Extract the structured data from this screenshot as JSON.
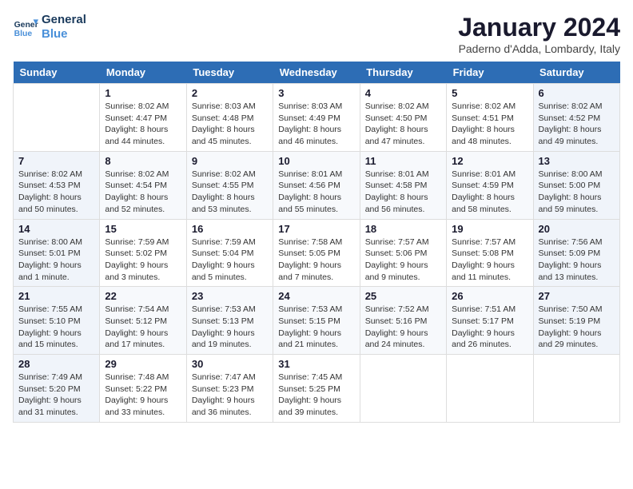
{
  "header": {
    "logo_line1": "General",
    "logo_line2": "Blue",
    "title": "January 2024",
    "location": "Paderno d'Adda, Lombardy, Italy"
  },
  "days_of_week": [
    "Sunday",
    "Monday",
    "Tuesday",
    "Wednesday",
    "Thursday",
    "Friday",
    "Saturday"
  ],
  "weeks": [
    [
      {
        "day": "",
        "sunrise": "",
        "sunset": "",
        "daylight": ""
      },
      {
        "day": "1",
        "sunrise": "Sunrise: 8:02 AM",
        "sunset": "Sunset: 4:47 PM",
        "daylight": "Daylight: 8 hours and 44 minutes."
      },
      {
        "day": "2",
        "sunrise": "Sunrise: 8:03 AM",
        "sunset": "Sunset: 4:48 PM",
        "daylight": "Daylight: 8 hours and 45 minutes."
      },
      {
        "day": "3",
        "sunrise": "Sunrise: 8:03 AM",
        "sunset": "Sunset: 4:49 PM",
        "daylight": "Daylight: 8 hours and 46 minutes."
      },
      {
        "day": "4",
        "sunrise": "Sunrise: 8:02 AM",
        "sunset": "Sunset: 4:50 PM",
        "daylight": "Daylight: 8 hours and 47 minutes."
      },
      {
        "day": "5",
        "sunrise": "Sunrise: 8:02 AM",
        "sunset": "Sunset: 4:51 PM",
        "daylight": "Daylight: 8 hours and 48 minutes."
      },
      {
        "day": "6",
        "sunrise": "Sunrise: 8:02 AM",
        "sunset": "Sunset: 4:52 PM",
        "daylight": "Daylight: 8 hours and 49 minutes."
      }
    ],
    [
      {
        "day": "7",
        "sunrise": "Sunrise: 8:02 AM",
        "sunset": "Sunset: 4:53 PM",
        "daylight": "Daylight: 8 hours and 50 minutes."
      },
      {
        "day": "8",
        "sunrise": "Sunrise: 8:02 AM",
        "sunset": "Sunset: 4:54 PM",
        "daylight": "Daylight: 8 hours and 52 minutes."
      },
      {
        "day": "9",
        "sunrise": "Sunrise: 8:02 AM",
        "sunset": "Sunset: 4:55 PM",
        "daylight": "Daylight: 8 hours and 53 minutes."
      },
      {
        "day": "10",
        "sunrise": "Sunrise: 8:01 AM",
        "sunset": "Sunset: 4:56 PM",
        "daylight": "Daylight: 8 hours and 55 minutes."
      },
      {
        "day": "11",
        "sunrise": "Sunrise: 8:01 AM",
        "sunset": "Sunset: 4:58 PM",
        "daylight": "Daylight: 8 hours and 56 minutes."
      },
      {
        "day": "12",
        "sunrise": "Sunrise: 8:01 AM",
        "sunset": "Sunset: 4:59 PM",
        "daylight": "Daylight: 8 hours and 58 minutes."
      },
      {
        "day": "13",
        "sunrise": "Sunrise: 8:00 AM",
        "sunset": "Sunset: 5:00 PM",
        "daylight": "Daylight: 8 hours and 59 minutes."
      }
    ],
    [
      {
        "day": "14",
        "sunrise": "Sunrise: 8:00 AM",
        "sunset": "Sunset: 5:01 PM",
        "daylight": "Daylight: 9 hours and 1 minute."
      },
      {
        "day": "15",
        "sunrise": "Sunrise: 7:59 AM",
        "sunset": "Sunset: 5:02 PM",
        "daylight": "Daylight: 9 hours and 3 minutes."
      },
      {
        "day": "16",
        "sunrise": "Sunrise: 7:59 AM",
        "sunset": "Sunset: 5:04 PM",
        "daylight": "Daylight: 9 hours and 5 minutes."
      },
      {
        "day": "17",
        "sunrise": "Sunrise: 7:58 AM",
        "sunset": "Sunset: 5:05 PM",
        "daylight": "Daylight: 9 hours and 7 minutes."
      },
      {
        "day": "18",
        "sunrise": "Sunrise: 7:57 AM",
        "sunset": "Sunset: 5:06 PM",
        "daylight": "Daylight: 9 hours and 9 minutes."
      },
      {
        "day": "19",
        "sunrise": "Sunrise: 7:57 AM",
        "sunset": "Sunset: 5:08 PM",
        "daylight": "Daylight: 9 hours and 11 minutes."
      },
      {
        "day": "20",
        "sunrise": "Sunrise: 7:56 AM",
        "sunset": "Sunset: 5:09 PM",
        "daylight": "Daylight: 9 hours and 13 minutes."
      }
    ],
    [
      {
        "day": "21",
        "sunrise": "Sunrise: 7:55 AM",
        "sunset": "Sunset: 5:10 PM",
        "daylight": "Daylight: 9 hours and 15 minutes."
      },
      {
        "day": "22",
        "sunrise": "Sunrise: 7:54 AM",
        "sunset": "Sunset: 5:12 PM",
        "daylight": "Daylight: 9 hours and 17 minutes."
      },
      {
        "day": "23",
        "sunrise": "Sunrise: 7:53 AM",
        "sunset": "Sunset: 5:13 PM",
        "daylight": "Daylight: 9 hours and 19 minutes."
      },
      {
        "day": "24",
        "sunrise": "Sunrise: 7:53 AM",
        "sunset": "Sunset: 5:15 PM",
        "daylight": "Daylight: 9 hours and 21 minutes."
      },
      {
        "day": "25",
        "sunrise": "Sunrise: 7:52 AM",
        "sunset": "Sunset: 5:16 PM",
        "daylight": "Daylight: 9 hours and 24 minutes."
      },
      {
        "day": "26",
        "sunrise": "Sunrise: 7:51 AM",
        "sunset": "Sunset: 5:17 PM",
        "daylight": "Daylight: 9 hours and 26 minutes."
      },
      {
        "day": "27",
        "sunrise": "Sunrise: 7:50 AM",
        "sunset": "Sunset: 5:19 PM",
        "daylight": "Daylight: 9 hours and 29 minutes."
      }
    ],
    [
      {
        "day": "28",
        "sunrise": "Sunrise: 7:49 AM",
        "sunset": "Sunset: 5:20 PM",
        "daylight": "Daylight: 9 hours and 31 minutes."
      },
      {
        "day": "29",
        "sunrise": "Sunrise: 7:48 AM",
        "sunset": "Sunset: 5:22 PM",
        "daylight": "Daylight: 9 hours and 33 minutes."
      },
      {
        "day": "30",
        "sunrise": "Sunrise: 7:47 AM",
        "sunset": "Sunset: 5:23 PM",
        "daylight": "Daylight: 9 hours and 36 minutes."
      },
      {
        "day": "31",
        "sunrise": "Sunrise: 7:45 AM",
        "sunset": "Sunset: 5:25 PM",
        "daylight": "Daylight: 9 hours and 39 minutes."
      },
      {
        "day": "",
        "sunrise": "",
        "sunset": "",
        "daylight": ""
      },
      {
        "day": "",
        "sunrise": "",
        "sunset": "",
        "daylight": ""
      },
      {
        "day": "",
        "sunrise": "",
        "sunset": "",
        "daylight": ""
      }
    ]
  ]
}
